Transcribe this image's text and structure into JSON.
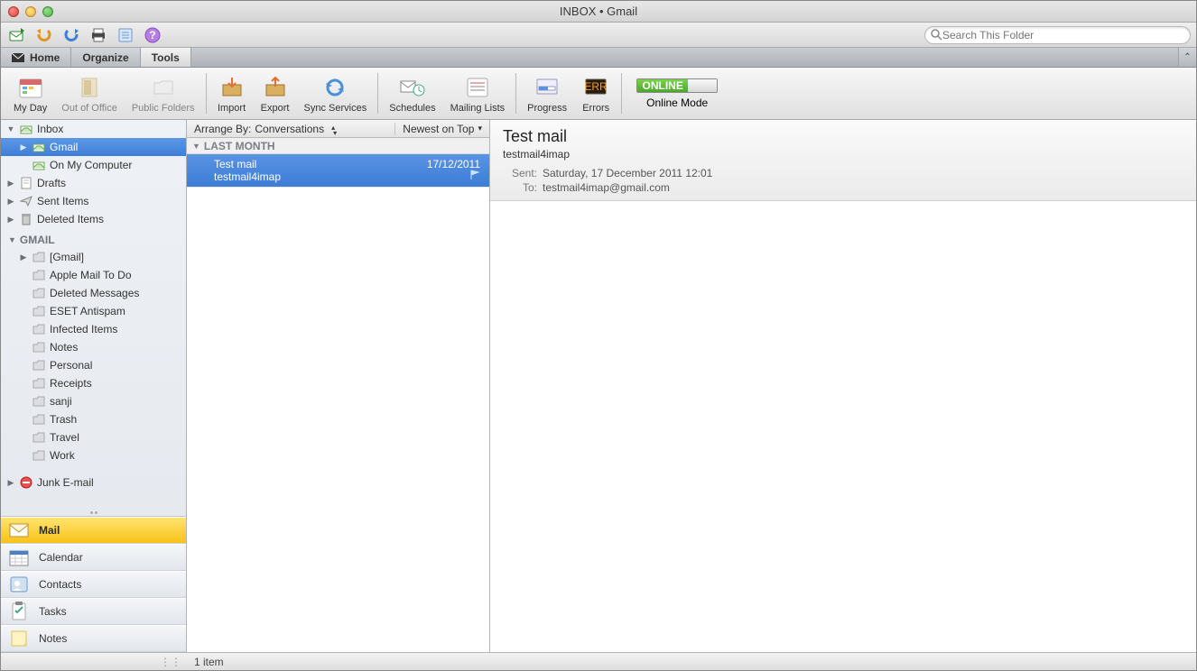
{
  "window": {
    "title": "INBOX • Gmail"
  },
  "search": {
    "placeholder": "Search This Folder"
  },
  "tabs": [
    {
      "label": "Home"
    },
    {
      "label": "Organize"
    },
    {
      "label": "Tools",
      "active": true
    }
  ],
  "ribbon": {
    "my_day": "My Day",
    "out_of_office": "Out of Office",
    "public_folders": "Public Folders",
    "import": "Import",
    "export": "Export",
    "sync_services": "Sync Services",
    "schedules": "Schedules",
    "mailing_lists": "Mailing Lists",
    "progress": "Progress",
    "errors": "Errors",
    "online_status": "ONLINE",
    "online_mode": "Online Mode"
  },
  "sidebar": {
    "inbox": "Inbox",
    "gmail_sub": "Gmail",
    "on_my_computer": "On My Computer",
    "drafts": "Drafts",
    "sent_items": "Sent Items",
    "deleted_items": "Deleted Items",
    "gmail_section": "GMAIL",
    "gmail_folders": {
      "root": "[Gmail]",
      "apple_mail_todo": "Apple Mail To Do",
      "deleted_messages": "Deleted Messages",
      "eset_antispam": "ESET Antispam",
      "infected_items": "Infected Items",
      "notes": "Notes",
      "personal": "Personal",
      "receipts": "Receipts",
      "sanji": "sanji",
      "trash": "Trash",
      "travel": "Travel",
      "work": "Work"
    },
    "junk": "Junk E-mail"
  },
  "nav": {
    "mail": "Mail",
    "calendar": "Calendar",
    "contacts": "Contacts",
    "tasks": "Tasks",
    "notes": "Notes"
  },
  "listheader": {
    "arrange_by_label": "Arrange By:",
    "arrange_by_value": "Conversations",
    "sort": "Newest on Top"
  },
  "group": {
    "last_month": "LAST MONTH"
  },
  "messages": [
    {
      "subject": "Test mail",
      "from": "testmail4imap",
      "date": "17/12/2011"
    }
  ],
  "reader": {
    "subject": "Test mail",
    "sender": "testmail4imap",
    "sent_label": "Sent:",
    "sent_value": "Saturday, 17 December 2011 12:01",
    "to_label": "To:",
    "to_value": "testmail4imap@gmail.com"
  },
  "status": {
    "item_count": "1 item"
  }
}
